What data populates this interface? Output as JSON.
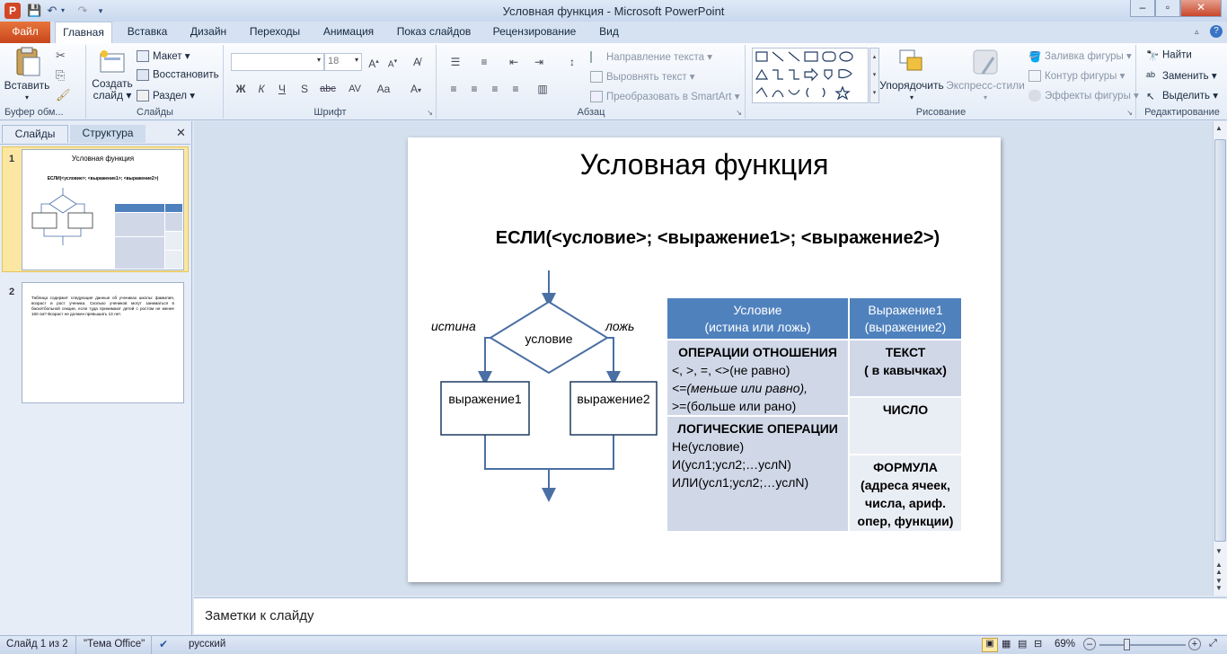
{
  "window": {
    "title": "Условная функция  -  Microsoft PowerPoint",
    "minimize": "–",
    "maximize": "▫",
    "close": "✕"
  },
  "quick_access": {
    "app_logo": "P"
  },
  "ribbon_tabs": [
    "Файл",
    "Главная",
    "Вставка",
    "Дизайн",
    "Переходы",
    "Анимация",
    "Показ слайдов",
    "Рецензирование",
    "Вид"
  ],
  "ribbon": {
    "clipboard": {
      "paste": "Вставить",
      "label": "Буфер обм..."
    },
    "slides": {
      "new_slide_line1": "Создать",
      "new_slide_line2": "слайд",
      "layout": "Макет",
      "reset": "Восстановить",
      "section": "Раздел",
      "label": "Слайды"
    },
    "font": {
      "font_name": "",
      "font_size": "18",
      "label": "Шрифт",
      "bold": "Ж",
      "italic": "К",
      "underline": "Ч",
      "strike": "abc",
      "shadow": "S",
      "spacing": "AV",
      "case": "Aa"
    },
    "paragraph": {
      "text_direction": "Направление текста",
      "align_text": "Выровнять текст",
      "smartart": "Преобразовать в SmartArt",
      "label": "Абзац"
    },
    "drawing": {
      "arrange": "Упорядочить",
      "quick_styles": "Экспресс-стили",
      "fill": "Заливка фигуры",
      "outline": "Контур фигуры",
      "effects": "Эффекты фигуры",
      "label": "Рисование"
    },
    "editing": {
      "find": "Найти",
      "replace": "Заменить",
      "select": "Выделить",
      "label": "Редактирование"
    }
  },
  "left_panel": {
    "tab_slides": "Слайды",
    "tab_outline": "Структура",
    "thumb1_number": "1",
    "thumb1_title": "Условная функция",
    "thumb1_formula": "ЕСЛИ(<условие>; <выражение1>; <выражение2>)",
    "thumb2_number": "2",
    "thumb2_text": "Таблица содержит следующие данные об учениках школы: фамилия, возраст и рост ученика. Сколько учеников могут заниматься в баскетбольной секции, если туда принимают детей с ростом не менее 160 см? Возраст не должен превышать 13 лет."
  },
  "slide": {
    "title": "Условная функция",
    "formula": "ЕСЛИ(<условие>; <выражение1>; <выражение2>)",
    "flow": {
      "true_label": "истина",
      "false_label": "ложь",
      "condition": "условие",
      "expr1": "выражение1",
      "expr2": "выражение2"
    },
    "table": {
      "header1_line1": "Условие",
      "header1_line2": "(истина или ложь)",
      "header2_line1": "Выражение1",
      "header2_line2": "(выражение2)",
      "relational_title": "ОПЕРАЦИИ ОТНОШЕНИЯ",
      "relational_line1": "<, >, =, <>(не  равно)",
      "relational_line2": "<=(меньше или равно),",
      "relational_line3": ">=(больше или рано)",
      "logical_title": "ЛОГИЧЕСКИЕ ОПЕРАЦИИ",
      "logical_line1": "Не(условие)",
      "logical_line2": "И(усл1;усл2;…услN)",
      "logical_line3": "ИЛИ(усл1;усл2;…услN)",
      "text_title": "ТЕКСТ",
      "text_sub": "( в кавычках)",
      "number": "ЧИСЛО",
      "formula_title": "ФОРМУЛА",
      "formula_line1": "(адреса ячеек,",
      "formula_line2": "числа, ариф.",
      "formula_line3": "опер, функции)"
    }
  },
  "notes": {
    "placeholder": "Заметки к слайду"
  },
  "status": {
    "slide_info": "Слайд 1 из 2",
    "theme": "\"Тема Office\"",
    "language": "русский",
    "zoom": "69%"
  }
}
